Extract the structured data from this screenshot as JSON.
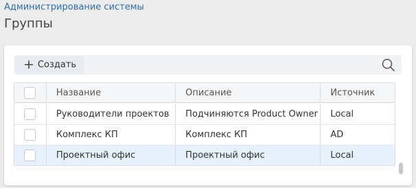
{
  "breadcrumb": "Администрирование системы",
  "page_title": "Группы",
  "toolbar": {
    "create_label": "Создать",
    "create_icon": "plus-icon",
    "search_icon": "search-icon"
  },
  "table": {
    "columns": [
      "Название",
      "Описание",
      "Источник"
    ],
    "rows": [
      {
        "name": "Руководители проектов",
        "description": "Подчиняются Product Owner",
        "source": "Local"
      },
      {
        "name": "Комплекс КП",
        "description": "Комплекс КП",
        "source": "AD"
      },
      {
        "name": "Проектный офис",
        "description": "Проектный офис",
        "source": "Local"
      }
    ]
  },
  "colors": {
    "accent": "#2f6fa9",
    "selected_row": "#e7f1fb"
  }
}
